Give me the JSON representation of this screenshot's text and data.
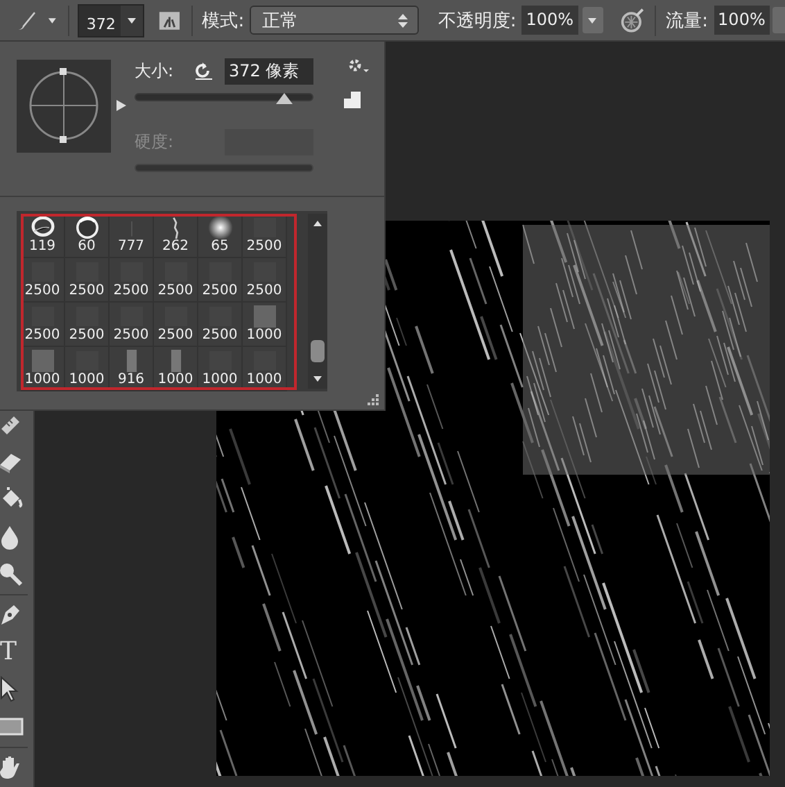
{
  "toolbar": {
    "brush_size": "372",
    "mode_label": "模式:",
    "mode_value": "正常",
    "opacity_label": "不透明度:",
    "opacity_value": "100%",
    "flow_label": "流量:",
    "flow_value": "100%"
  },
  "brush_panel": {
    "size_label": "大小:",
    "size_value": "372 像素",
    "size_slider": {
      "level": 0.84
    },
    "hardness_label": "硬度:",
    "hardness_disabled": true,
    "presets": [
      {
        "kind": "round",
        "size": "119"
      },
      {
        "kind": "bubble",
        "size": "60"
      },
      {
        "kind": "line",
        "size": "777"
      },
      {
        "kind": "splatter",
        "size": "262"
      },
      {
        "kind": "soft",
        "size": "65"
      },
      {
        "kind": "texture",
        "size": "2500"
      },
      {
        "kind": "texture",
        "size": "2500"
      },
      {
        "kind": "texture",
        "size": "2500"
      },
      {
        "kind": "texture",
        "size": "2500"
      },
      {
        "kind": "texture",
        "size": "2500"
      },
      {
        "kind": "texture",
        "size": "2500"
      },
      {
        "kind": "texture",
        "size": "2500"
      },
      {
        "kind": "texture",
        "size": "2500"
      },
      {
        "kind": "texture",
        "size": "2500"
      },
      {
        "kind": "texture",
        "size": "2500"
      },
      {
        "kind": "texture",
        "size": "2500"
      },
      {
        "kind": "texture",
        "size": "2500"
      },
      {
        "kind": "square",
        "size": "1000"
      },
      {
        "kind": "square",
        "size": "1000"
      },
      {
        "kind": "texture",
        "size": "1000"
      },
      {
        "kind": "bar",
        "size": "916"
      },
      {
        "kind": "bar",
        "size": "1000"
      },
      {
        "kind": "texture",
        "size": "1000"
      },
      {
        "kind": "texture",
        "size": "1000"
      }
    ]
  },
  "tools": [
    {
      "kind": "healing"
    },
    {
      "kind": "eraser"
    },
    {
      "kind": "bucket"
    },
    {
      "kind": "drop"
    },
    {
      "kind": "dodge"
    },
    {
      "kind": "pen"
    },
    {
      "kind": "type",
      "glyph": "T"
    },
    {
      "kind": "select"
    },
    {
      "kind": "rectangle"
    },
    {
      "kind": "hand"
    }
  ]
}
